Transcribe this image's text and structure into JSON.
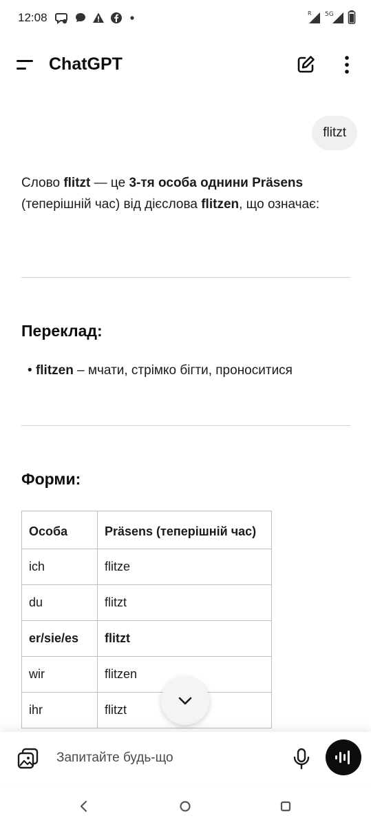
{
  "status_bar": {
    "time": "12:08",
    "icons_left": [
      "messenger-icon",
      "chat-bubble-icon",
      "alert-icon",
      "facebook-icon",
      "dot-icon"
    ],
    "icons_right": [
      "roaming-signal-icon",
      "5g-signal-icon",
      "battery-icon"
    ],
    "network": "5G",
    "roaming": "R"
  },
  "header": {
    "title": "ChatGPT"
  },
  "conversation": {
    "user_message": "flitzt",
    "intro": {
      "p1": "Слово ",
      "b1": "flitzt",
      "p2": " — це ",
      "b2": "3-тя особа однини Präsens",
      "p3": " (теперішній час) від дієслова ",
      "b3": "flitzen",
      "p4": ", що означає:"
    },
    "translation_heading": "Переклад:",
    "bullet": {
      "marker": "•",
      "term": "flitzen",
      "meaning": " – мчати, стрімко бігти, проноситися"
    },
    "forms_heading": "Форми:",
    "table": {
      "headers": [
        "Особа",
        "Präsens (теперішній час)"
      ],
      "rows": [
        [
          "ich",
          "flitze"
        ],
        [
          "du",
          "flitzt"
        ],
        [
          "er/sie/es",
          "flitzt"
        ],
        [
          "wir",
          "flitzen"
        ],
        [
          "ihr",
          "flitzt"
        ]
      ]
    }
  },
  "composer": {
    "placeholder": "Запитайте будь-що"
  },
  "colors": {
    "accent": "#0d0d0d",
    "bubble": "#f0f0f0",
    "divider": "#d0d0d0"
  }
}
